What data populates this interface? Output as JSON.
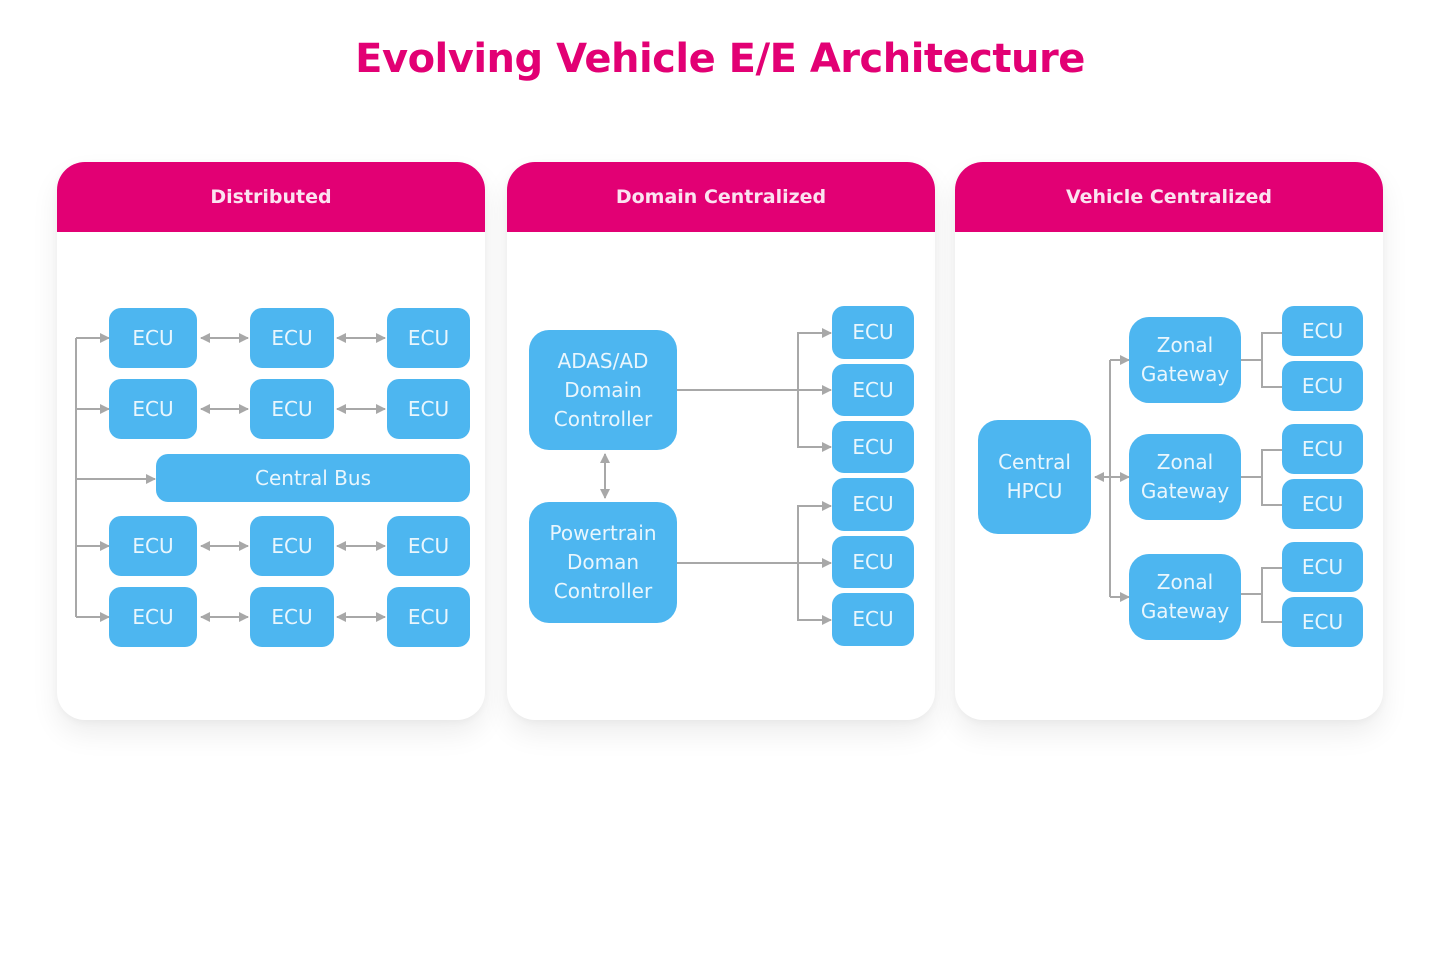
{
  "title": "Evolving Vehicle E/E Architecture",
  "colors": {
    "accent": "#e20074",
    "node": "#4db6f0",
    "connector": "#a8a8a8"
  },
  "panels": [
    {
      "heading": "Distributed",
      "central_bus": "Central Bus",
      "ecu_label": "ECU",
      "ecu_rows": 4,
      "ecu_cols": 3
    },
    {
      "heading": "Domain Centralized",
      "controllers": [
        "ADAS/AD\nDomain\nController",
        "Powertrain\nDoman\nController"
      ],
      "ecu_label": "ECU",
      "ecus_per_controller": 3
    },
    {
      "heading": "Vehicle Centralized",
      "central": "Central\nHPCU",
      "gateway_label": "Zonal\nGateway",
      "gateways": 3,
      "ecu_label": "ECU",
      "ecus_per_gateway": 2
    }
  ]
}
